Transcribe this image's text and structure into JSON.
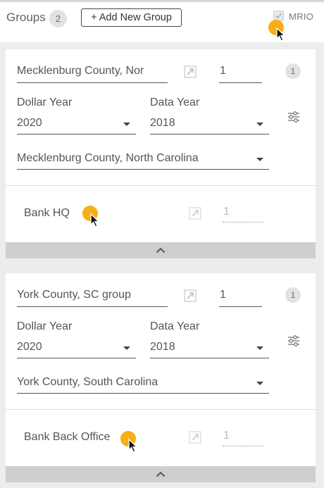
{
  "header": {
    "groups_label": "Groups",
    "groups_count": "2",
    "add_button_label": "+ Add New Group",
    "mrio_label": "MRIO",
    "mrio_checked": true
  },
  "groups": [
    {
      "name": "Mecklenburg County, Nor",
      "quantity": "1",
      "badge": "1",
      "dollar_year_label": "Dollar Year",
      "dollar_year": "2020",
      "data_year_label": "Data Year",
      "data_year": "2018",
      "region": "Mecklenburg County, North Carolina",
      "member": {
        "name": "Bank HQ",
        "quantity": "1"
      }
    },
    {
      "name": "York County, SC group",
      "quantity": "1",
      "badge": "1",
      "dollar_year_label": "Dollar Year",
      "dollar_year": "2020",
      "data_year_label": "Data Year",
      "data_year": "2018",
      "region": "York County, South Carolina",
      "member": {
        "name": "Bank Back Office",
        "quantity": "1"
      }
    }
  ],
  "colors": {
    "cursor_highlight": "#f5a800",
    "collapse_bar": "#cfcfcf",
    "background": "#ededed"
  },
  "icons": {
    "expand": "expand-arrow-icon",
    "settings": "sliders-icon",
    "collapse": "chevron-up-icon",
    "cursor": "mouse-pointer-icon"
  }
}
